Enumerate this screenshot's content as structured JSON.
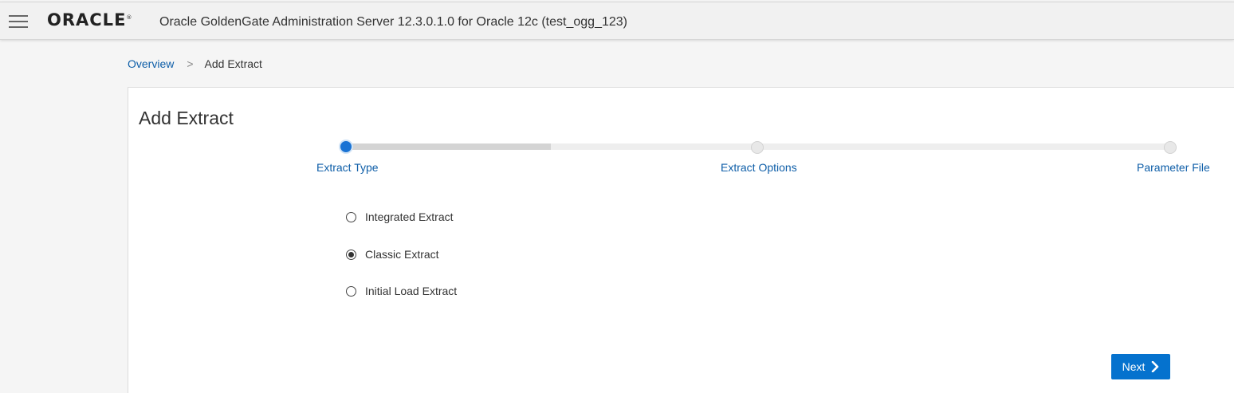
{
  "header": {
    "logo_text": "ORACLE",
    "logo_mark": "®",
    "title": "Oracle GoldenGate Administration Server 12.3.0.1.0 for Oracle 12c (test_ogg_123)"
  },
  "breadcrumb": {
    "items": [
      "Overview",
      "Add Extract"
    ],
    "separator": ">"
  },
  "page": {
    "title": "Add Extract"
  },
  "wizard": {
    "steps": [
      {
        "label": "Extract Type",
        "status": "active"
      },
      {
        "label": "Extract Options",
        "status": "pending"
      },
      {
        "label": "Parameter File",
        "status": "pending"
      }
    ],
    "progress_fraction": 0.25
  },
  "extract_types": {
    "options": [
      {
        "label": "Integrated Extract",
        "checked": false
      },
      {
        "label": "Classic Extract",
        "checked": true
      },
      {
        "label": "Initial Load Extract",
        "checked": false
      }
    ]
  },
  "actions": {
    "next_label": "Next",
    "next_icon": "chevron-right-icon"
  },
  "colors": {
    "accent": "#0572ce",
    "link": "#0e5ea8",
    "active_step": "#1a73d4"
  }
}
